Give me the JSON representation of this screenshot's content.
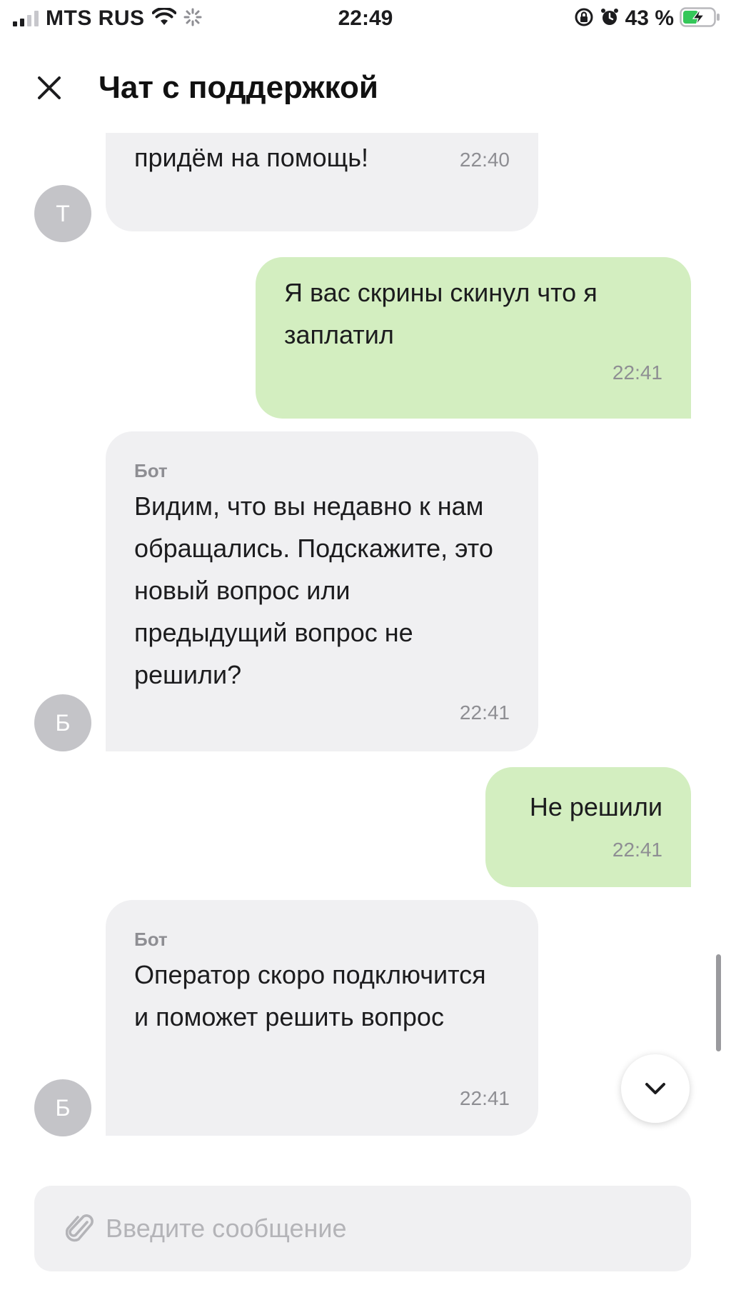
{
  "status_bar": {
    "carrier": "MTS RUS",
    "time": "22:49",
    "battery": "43 %",
    "signal_bars_filled": 2,
    "signal_bars_total": 4
  },
  "header": {
    "title": "Чат с поддержкой",
    "close_icon": "close-icon"
  },
  "messages": [
    {
      "direction": "incoming",
      "avatar": "Т",
      "sender": "",
      "text_visible": "придём на помощь!",
      "time": "22:40",
      "partially_scrolled": true
    },
    {
      "direction": "outgoing",
      "text": "Я вас скрины скинул что я заплатил",
      "time": "22:41"
    },
    {
      "direction": "incoming",
      "avatar": "Б",
      "sender": "Бот",
      "text": "Видим, что вы недавно к нам обращались. Подскажите, это новый вопрос или предыдущий вопрос не решили?",
      "time": "22:41"
    },
    {
      "direction": "outgoing",
      "text": "Не решили",
      "time": "22:41"
    },
    {
      "direction": "incoming",
      "avatar": "Б",
      "sender": "Бот",
      "text": "Оператор скоро подключится и поможет решить вопрос",
      "time": "22:41"
    }
  ],
  "scroll_down_icon": "chevron-down-icon",
  "composer": {
    "placeholder": "Введите сообщение",
    "value": "",
    "attach_icon": "paperclip-icon"
  },
  "colors": {
    "incoming_bubble": "#f0f0f2",
    "outgoing_bubble": "#d3eec0",
    "avatar": "#c4c4c8",
    "battery_charging": "#34c759"
  }
}
